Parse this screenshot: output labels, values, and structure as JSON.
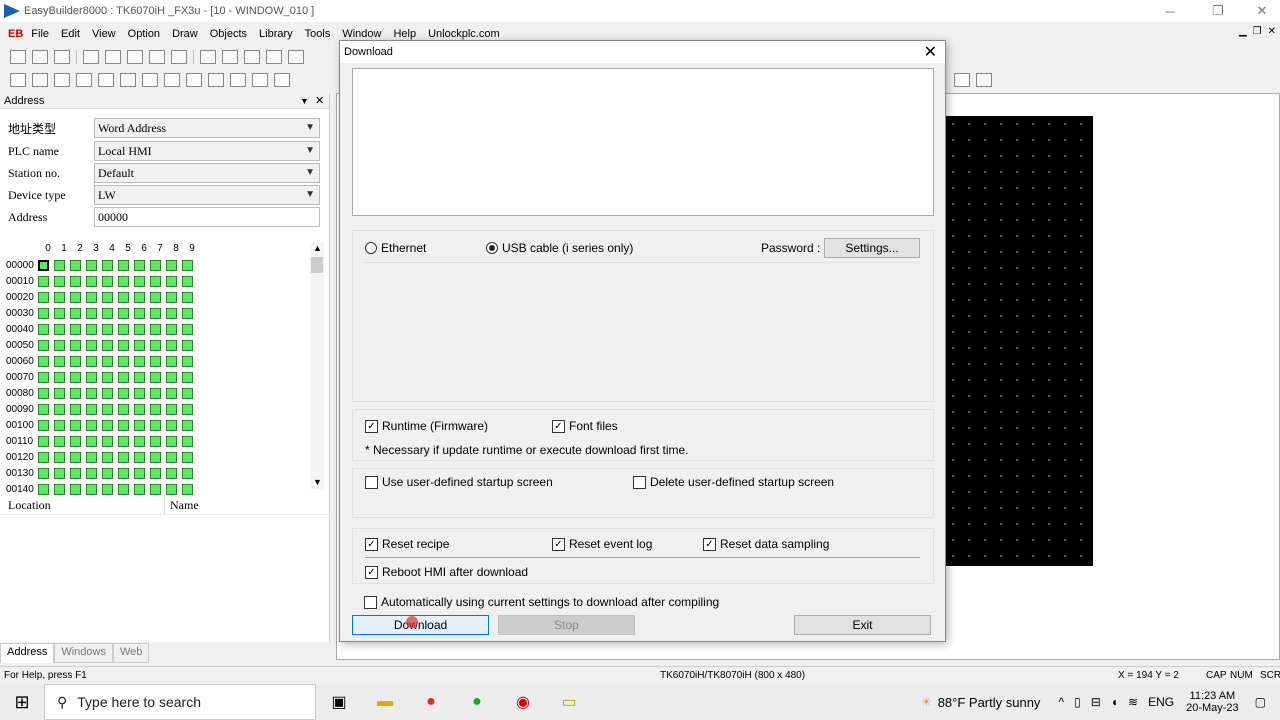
{
  "window": {
    "title": "EasyBuilder8000 : TK6070iH _FX3u - [10 - WINDOW_010 ]"
  },
  "menu": {
    "logo": "EB",
    "items": [
      "File",
      "Edit",
      "View",
      "Option",
      "Draw",
      "Objects",
      "Library",
      "Tools",
      "Window",
      "Help",
      "Unlockplc.com"
    ]
  },
  "address_panel": {
    "title": "Address",
    "fields": [
      {
        "label": "地址类型",
        "value": "Word Address"
      },
      {
        "label": "PLC name",
        "value": "Local HMI"
      },
      {
        "label": "Station no.",
        "value": "Default"
      },
      {
        "label": "Device type",
        "value": "LW"
      },
      {
        "label": "Address",
        "value": "00000"
      }
    ],
    "col_headers": [
      "0",
      "1",
      "2",
      "3",
      "4",
      "5",
      "6",
      "7",
      "8",
      "9"
    ],
    "row_labels": [
      "00000",
      "00010",
      "00020",
      "00030",
      "00040",
      "00050",
      "00060",
      "00070",
      "00080",
      "00090",
      "00100",
      "00110",
      "00120",
      "00130",
      "00140"
    ],
    "location_label": "Location",
    "name_label": "Name",
    "tabs": [
      "Address",
      "Windows",
      "Web"
    ]
  },
  "dialog": {
    "title": "Download",
    "ethernet_label": "Ethernet",
    "usb_label": "USB cable (i series only)",
    "password_label": "Password :",
    "settings_button": "Settings...",
    "runtime_label": "Runtime (Firmware)",
    "font_label": "Font files",
    "necessary_note": "* Necessary if update runtime or execute download first time.",
    "use_startup_label": "Use user-defined startup screen",
    "delete_startup_label": "Delete user-defined startup screen",
    "reset_recipe_label": "Reset recipe",
    "reset_event_label": "Reset event log",
    "reset_sampling_label": "Reset data sampling",
    "reboot_label": "Reboot HMI after download",
    "auto_label": "Automatically using current settings to download after compiling",
    "download_button": "Download",
    "stop_button": "Stop",
    "exit_button": "Exit"
  },
  "statusbar": {
    "help": "For Help, press F1",
    "model": "TK6070iH/TK8070iH (800 x 480)",
    "coords": "X = 194   Y = 2",
    "caps": "CAP",
    "num": "NUM",
    "scr": "SCR"
  },
  "taskbar": {
    "search_placeholder": "Type here to search",
    "weather": "88°F  Partly sunny",
    "lang": "ENG",
    "time": "11:23 AM",
    "date": "20-May-23"
  }
}
